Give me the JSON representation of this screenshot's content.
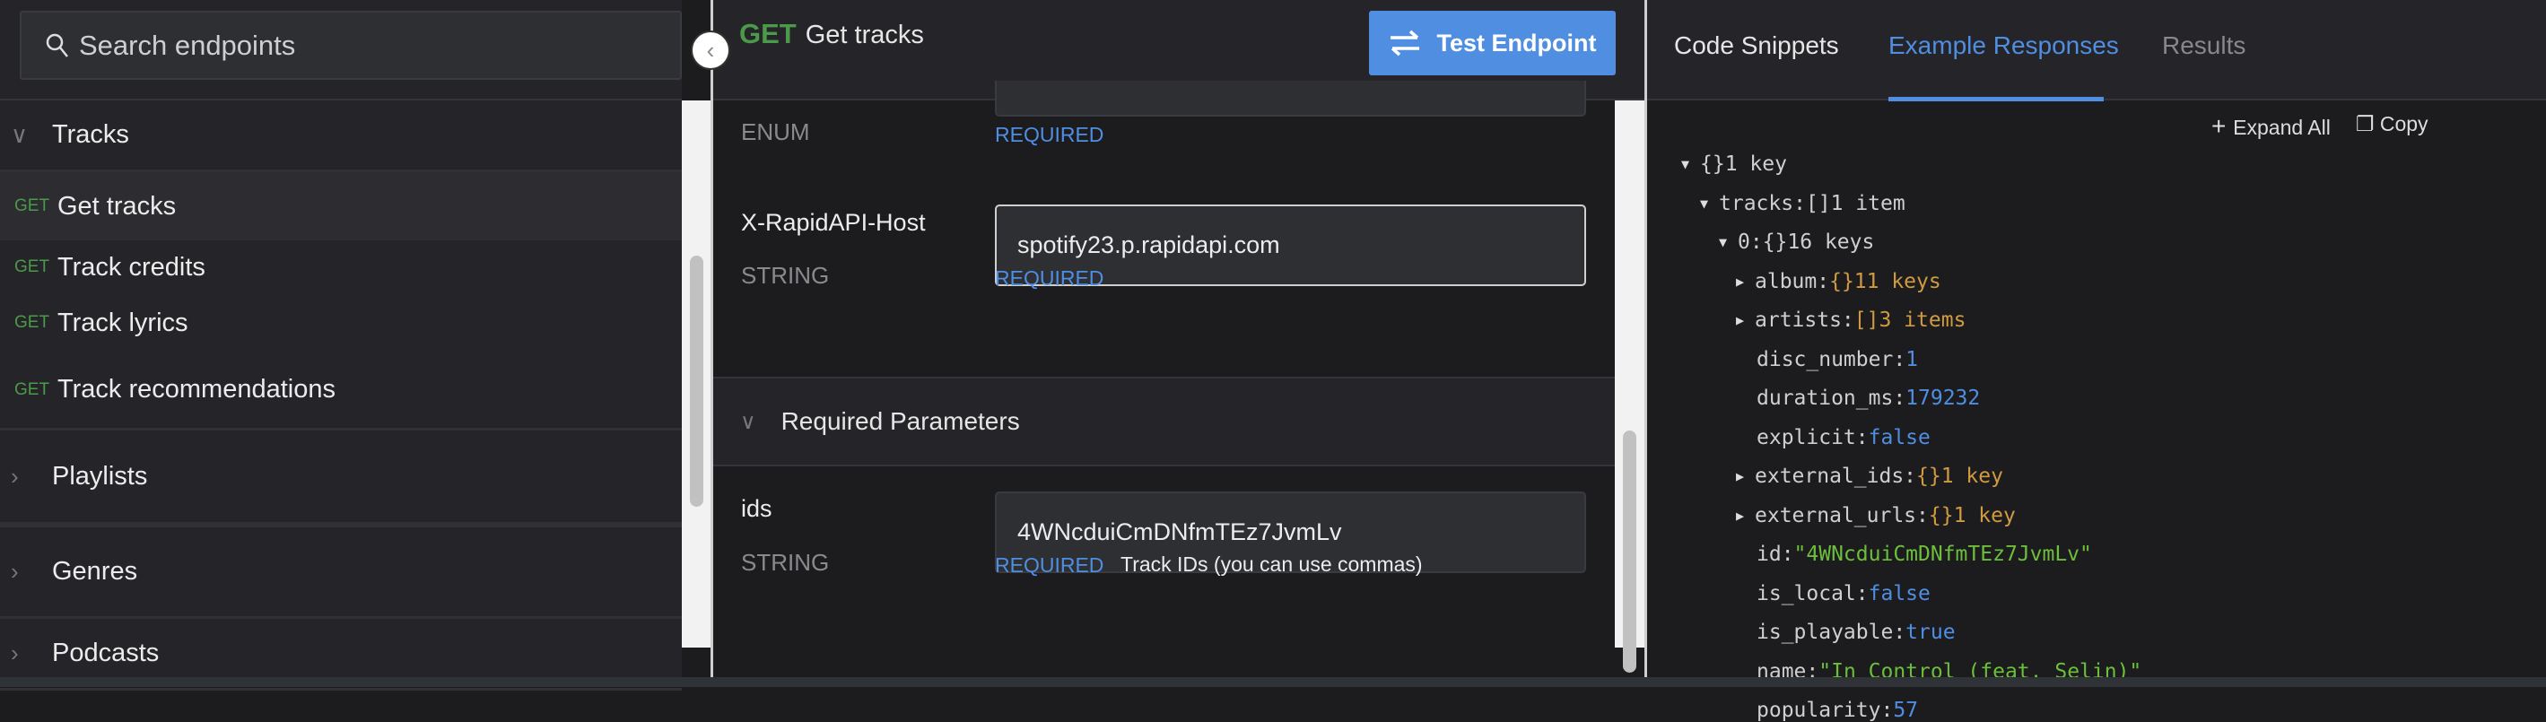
{
  "sidebar": {
    "search_placeholder": "Search endpoints",
    "groups": [
      {
        "label": "Tracks",
        "expanded": true
      },
      {
        "label": "Playlists"
      },
      {
        "label": "Genres"
      },
      {
        "label": "Podcasts"
      }
    ],
    "endpoints": [
      {
        "method": "GET",
        "label": "Get tracks",
        "selected": true
      },
      {
        "method": "GET",
        "label": "Track credits"
      },
      {
        "method": "GET",
        "label": "Track lyrics"
      },
      {
        "method": "GET",
        "label": "Track recommendations"
      }
    ]
  },
  "endpoint": {
    "method": "GET",
    "title": "Get tracks",
    "test_button": "Test Endpoint"
  },
  "params": {
    "enum_type": "ENUM",
    "enum_required": "REQUIRED",
    "host": {
      "name": "X-RapidAPI-Host",
      "type": "STRING",
      "value": "spotify23.p.rapidapi.com",
      "required": "REQUIRED"
    },
    "section_title": "Required Parameters",
    "ids": {
      "name": "ids",
      "type": "STRING",
      "value": "4WNcduiCmDNfmTEz7JvmLv",
      "required": "REQUIRED",
      "hint": "Track IDs (you can use commas)"
    }
  },
  "right": {
    "tabs": [
      {
        "label": "Code Snippets"
      },
      {
        "label": "Example Responses",
        "active": true
      },
      {
        "label": "Results"
      }
    ],
    "expand_all": "Expand All",
    "copy": "Copy",
    "json": [
      {
        "key": "",
        "type": "{}",
        "summary": "1 key",
        "arrow": "▼"
      },
      {
        "key": "tracks:",
        "type": "[]",
        "summary": "1 item",
        "arrow": "▼"
      },
      {
        "key": "0:",
        "type": "{}",
        "summary": "16 keys",
        "arrow": "▼"
      },
      {
        "key": "album:",
        "type": "{}",
        "summary": "11 keys",
        "arrow": "▶"
      },
      {
        "key": "artists:",
        "type": "[]",
        "summary": "3 items",
        "arrow": "▶"
      },
      {
        "key": "disc_number:",
        "value": "1",
        "vtype": "num"
      },
      {
        "key": "duration_ms:",
        "value": "179232",
        "vtype": "num"
      },
      {
        "key": "explicit:",
        "value": "false",
        "vtype": "num"
      },
      {
        "key": "external_ids:",
        "type": "{}",
        "summary": "1 key",
        "arrow": "▶"
      },
      {
        "key": "external_urls:",
        "type": "{}",
        "summary": "1 key",
        "arrow": "▶"
      },
      {
        "key": "id:",
        "value": "\"4WNcduiCmDNfmTEz7JvmLv\"",
        "vtype": "str"
      },
      {
        "key": "is_local:",
        "value": "false",
        "vtype": "num"
      },
      {
        "key": "is_playable:",
        "value": "true",
        "vtype": "num"
      },
      {
        "key": "name:",
        "value": "\"In Control (feat. Selin)\"",
        "vtype": "str"
      },
      {
        "key": "popularity:",
        "value": "57",
        "vtype": "num"
      }
    ]
  },
  "colors": {
    "accent": "#4f8ee0",
    "get": "#4a9a4a",
    "object": "#d09a40",
    "string": "#6cbf3a"
  }
}
